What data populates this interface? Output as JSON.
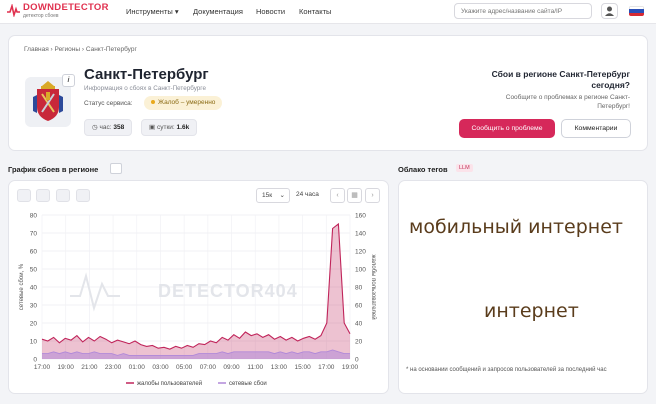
{
  "header": {
    "logo_title": "DOWNDETECTOR",
    "logo_subtitle": "детектор сбоев",
    "nav": [
      "Инструменты ▾",
      "Документация",
      "Новости",
      "Контакты"
    ],
    "search_placeholder": "Укажите адрес/название сайта/IP",
    "flag_colors": [
      "#ffffff",
      "#2a4fb8",
      "#d62a33"
    ]
  },
  "region": {
    "breadcrumb": "Главная › Регионы › Санкт-Петербург",
    "info_badge": "i",
    "name": "Санкт-Петербург",
    "subtitle": "Информация о сбоях в Санкт-Петербурге",
    "status_label": "Статус сервиса:",
    "status_value": "Жалоб – умеренно",
    "hour_label": "час:",
    "hour_value": "358",
    "day_label": "сутки:",
    "day_value": "1.6k",
    "question_title": "Сбои в регионе Санкт-Петербург сегодня?",
    "question_sub": "Сообщите о проблемах в регионе Санкт-Петербург!",
    "report_button": "Сообщить о проблеме",
    "comments_button": "Комментарии"
  },
  "chart_section": {
    "title": "График сбоев в регионе",
    "interval_select": "15к",
    "period": "24 часа",
    "watermark": "DETECTOR404"
  },
  "chart_data": {
    "type": "area",
    "x": [
      "17:00",
      "17:30",
      "18:00",
      "18:30",
      "19:00",
      "19:30",
      "20:00",
      "20:30",
      "21:00",
      "21:30",
      "22:00",
      "22:30",
      "23:00",
      "23:30",
      "00:00",
      "00:30",
      "01:00",
      "01:30",
      "02:00",
      "02:30",
      "03:00",
      "03:30",
      "04:00",
      "04:30",
      "05:00",
      "05:30",
      "06:00",
      "06:30",
      "07:00",
      "07:30",
      "08:00",
      "08:30",
      "09:00",
      "09:30",
      "10:00",
      "10:30",
      "11:00",
      "11:30",
      "12:00",
      "12:30",
      "13:00",
      "13:30",
      "14:00",
      "14:30",
      "15:00",
      "15:30",
      "16:00",
      "16:30",
      "17:00",
      "17:15",
      "17:30",
      "17:45",
      "18:00",
      "18:15"
    ],
    "x_ticks": [
      "17:00",
      "19:00",
      "21:00",
      "23:00",
      "01:00",
      "03:00",
      "05:00",
      "07:00",
      "09:00",
      "11:00",
      "13:00",
      "15:00",
      "17:00",
      "19:00"
    ],
    "y_left_ticks": [
      "0",
      "10",
      "20",
      "30",
      "40",
      "50",
      "60",
      "70",
      "80"
    ],
    "y_right_ticks": [
      "0",
      "20",
      "40",
      "60",
      "80",
      "100",
      "120",
      "140",
      "160"
    ],
    "ylabel_left": "сетевые сбои, %",
    "ylabel_right": "жалобы пользователей",
    "ylim_left": [
      0,
      80
    ],
    "ylim_right": [
      0,
      160
    ],
    "series": [
      {
        "name": "жалобы пользователей",
        "axis": "right",
        "color": "#c0245a",
        "values": [
          22,
          20,
          24,
          18,
          23,
          21,
          26,
          19,
          24,
          20,
          25,
          22,
          18,
          21,
          19,
          17,
          20,
          16,
          14,
          15,
          12,
          13,
          11,
          14,
          12,
          15,
          13,
          17,
          16,
          20,
          18,
          24,
          21,
          27,
          23,
          30,
          26,
          28,
          24,
          27,
          22,
          25,
          21,
          24,
          20,
          23,
          25,
          22,
          26,
          40,
          145,
          150,
          40,
          28
        ]
      },
      {
        "name": "сетевые сбои",
        "axis": "left",
        "color": "#b189d9",
        "values": [
          3,
          3,
          4,
          3,
          4,
          3,
          4,
          3,
          3,
          4,
          3,
          3,
          3,
          2,
          3,
          2,
          2,
          2,
          2,
          2,
          2,
          2,
          2,
          2,
          2,
          2,
          2,
          3,
          3,
          3,
          3,
          4,
          3,
          4,
          4,
          4,
          4,
          4,
          4,
          4,
          3,
          4,
          3,
          4,
          3,
          4,
          4,
          3,
          4,
          4,
          5,
          4,
          3,
          3
        ]
      }
    ],
    "legend": "bottom-center",
    "grid": true
  },
  "tags_section": {
    "title": "Облако тегов",
    "badge": "LLM",
    "tags": [
      "мобильный интернет",
      "интернет"
    ],
    "footnote": "* на основании сообщений и запросов пользователей за последний час"
  }
}
